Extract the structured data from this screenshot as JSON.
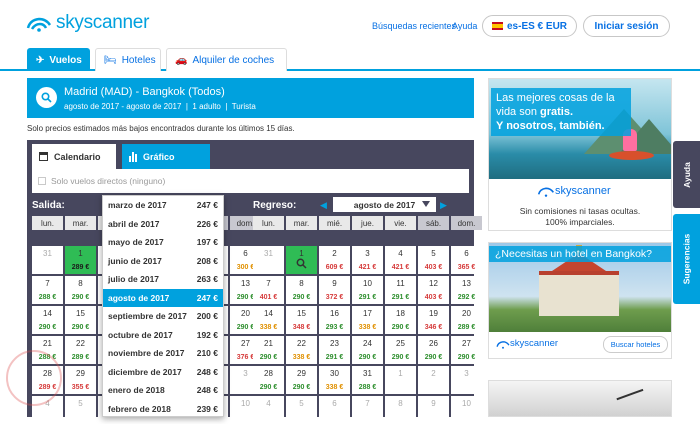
{
  "brand": {
    "name": "skyscanner",
    "color": "#00a1de"
  },
  "header": {
    "recent_searches": "Búsquedas recientes",
    "help": "Ayuda",
    "locale": "es-ES € EUR",
    "login": "Iniciar sesión"
  },
  "tabs": [
    {
      "label": "Vuelos",
      "icon": "plane-icon"
    },
    {
      "label": "Hoteles",
      "icon": "bed-icon"
    },
    {
      "label": "Alquiler de coches",
      "icon": "car-icon"
    }
  ],
  "search": {
    "route": "Madrid (MAD) - Bangkok (Todos)",
    "dates": "agosto de 2017 - agosto de 2017",
    "adults": "1 adulto",
    "cabin": "Turista"
  },
  "estimate_note": "Solo precios estimados más bajos encontrados durante los últimos 15 días.",
  "calendar": {
    "tab_calendar": "Calendario",
    "tab_chart": "Gráfico",
    "direct_only": "Solo vuelos directos (ninguno)",
    "outbound_label": "Salida:",
    "return_label": "Regreso:",
    "return_month": "agosto de 2017",
    "weekdays": [
      "lun.",
      "mar.",
      "mié.",
      "jue.",
      "vie.",
      "sáb.",
      "dom."
    ],
    "outbound_rows": [
      [
        {
          "d": "31",
          "p": "",
          "c": "",
          "dim": true
        },
        {
          "d": "1",
          "p": "289 €",
          "c": "g",
          "sel": true
        },
        {
          "d": "",
          "p": ""
        },
        {
          "d": "",
          "p": ""
        },
        {
          "d": "",
          "p": ""
        },
        {
          "d": "",
          "p": ""
        },
        {
          "d": "6",
          "p": "300 €",
          "c": "o"
        }
      ],
      [
        {
          "d": "7",
          "p": "288 €",
          "c": "g"
        },
        {
          "d": "8",
          "p": "290 €",
          "c": "g"
        },
        {
          "d": "",
          "p": ""
        },
        {
          "d": "",
          "p": ""
        },
        {
          "d": "",
          "p": ""
        },
        {
          "d": "",
          "p": ""
        },
        {
          "d": "13",
          "p": "290 €",
          "c": "g"
        }
      ],
      [
        {
          "d": "14",
          "p": "290 €",
          "c": "g"
        },
        {
          "d": "15",
          "p": "290 €",
          "c": "g"
        },
        {
          "d": "",
          "p": ""
        },
        {
          "d": "",
          "p": ""
        },
        {
          "d": "",
          "p": ""
        },
        {
          "d": "",
          "p": ""
        },
        {
          "d": "20",
          "p": "290 €",
          "c": "g"
        }
      ],
      [
        {
          "d": "21",
          "p": "288 €",
          "c": "g"
        },
        {
          "d": "22",
          "p": "289 €",
          "c": "g"
        },
        {
          "d": "",
          "p": ""
        },
        {
          "d": "",
          "p": ""
        },
        {
          "d": "",
          "p": ""
        },
        {
          "d": "",
          "p": ""
        },
        {
          "d": "27",
          "p": "376 €",
          "c": "r"
        }
      ],
      [
        {
          "d": "28",
          "p": "289 €",
          "c": "r"
        },
        {
          "d": "29",
          "p": "355 €",
          "c": "r"
        },
        {
          "d": "",
          "p": ""
        },
        {
          "d": "",
          "p": ""
        },
        {
          "d": "",
          "p": ""
        },
        {
          "d": "",
          "p": ""
        },
        {
          "d": "3",
          "p": "",
          "dim": true
        }
      ],
      [
        {
          "d": "4",
          "p": "",
          "dim": true
        },
        {
          "d": "5",
          "p": "",
          "dim": true
        },
        {
          "d": "",
          "p": ""
        },
        {
          "d": "",
          "p": ""
        },
        {
          "d": "",
          "p": ""
        },
        {
          "d": "",
          "p": ""
        },
        {
          "d": "10",
          "p": "",
          "dim": true
        }
      ]
    ],
    "return_rows": [
      [
        {
          "d": "31",
          "p": "",
          "dim": true
        },
        {
          "d": "1",
          "p": "",
          "sel": true,
          "search": true
        },
        {
          "d": "2",
          "p": "609 €",
          "c": "r"
        },
        {
          "d": "3",
          "p": "421 €",
          "c": "r"
        },
        {
          "d": "4",
          "p": "421 €",
          "c": "r"
        },
        {
          "d": "5",
          "p": "403 €",
          "c": "r"
        },
        {
          "d": "6",
          "p": "365 €",
          "c": "r"
        }
      ],
      [
        {
          "d": "7",
          "p": "401 €",
          "c": "r"
        },
        {
          "d": "8",
          "p": "290 €",
          "c": "g"
        },
        {
          "d": "9",
          "p": "372 €",
          "c": "r"
        },
        {
          "d": "10",
          "p": "291 €",
          "c": "g"
        },
        {
          "d": "11",
          "p": "291 €",
          "c": "g"
        },
        {
          "d": "12",
          "p": "403 €",
          "c": "r"
        },
        {
          "d": "13",
          "p": "292 €",
          "c": "g"
        }
      ],
      [
        {
          "d": "14",
          "p": "338 €",
          "c": "o"
        },
        {
          "d": "15",
          "p": "348 €",
          "c": "r"
        },
        {
          "d": "16",
          "p": "293 €",
          "c": "g"
        },
        {
          "d": "17",
          "p": "338 €",
          "c": "o"
        },
        {
          "d": "18",
          "p": "290 €",
          "c": "g"
        },
        {
          "d": "19",
          "p": "346 €",
          "c": "r"
        },
        {
          "d": "20",
          "p": "289 €",
          "c": "g"
        }
      ],
      [
        {
          "d": "21",
          "p": "290 €",
          "c": "g"
        },
        {
          "d": "22",
          "p": "338 €",
          "c": "o"
        },
        {
          "d": "23",
          "p": "291 €",
          "c": "g"
        },
        {
          "d": "24",
          "p": "290 €",
          "c": "g"
        },
        {
          "d": "25",
          "p": "290 €",
          "c": "g"
        },
        {
          "d": "26",
          "p": "290 €",
          "c": "g"
        },
        {
          "d": "27",
          "p": "290 €",
          "c": "g"
        }
      ],
      [
        {
          "d": "28",
          "p": "290 €",
          "c": "g"
        },
        {
          "d": "29",
          "p": "290 €",
          "c": "g"
        },
        {
          "d": "30",
          "p": "338 €",
          "c": "o"
        },
        {
          "d": "31",
          "p": "288 €",
          "c": "g"
        },
        {
          "d": "1",
          "p": "",
          "dim": true
        },
        {
          "d": "2",
          "p": "",
          "dim": true
        },
        {
          "d": "3",
          "p": "",
          "dim": true
        }
      ],
      [
        {
          "d": "4",
          "p": "",
          "dim": true
        },
        {
          "d": "5",
          "p": "",
          "dim": true
        },
        {
          "d": "6",
          "p": "",
          "dim": true
        },
        {
          "d": "7",
          "p": "",
          "dim": true
        },
        {
          "d": "8",
          "p": "",
          "dim": true
        },
        {
          "d": "9",
          "p": "",
          "dim": true
        },
        {
          "d": "10",
          "p": "",
          "dim": true
        }
      ]
    ],
    "month_dropdown": [
      {
        "m": "marzo de 2017",
        "p": "247 €"
      },
      {
        "m": "abril de 2017",
        "p": "226 €"
      },
      {
        "m": "mayo de 2017",
        "p": "197 €"
      },
      {
        "m": "junio de 2017",
        "p": "208 €"
      },
      {
        "m": "julio de 2017",
        "p": "263 €"
      },
      {
        "m": "agosto de 2017",
        "p": "247 €",
        "sel": true
      },
      {
        "m": "septiembre de 2017",
        "p": "200 €"
      },
      {
        "m": "octubre de 2017",
        "p": "192 €"
      },
      {
        "m": "noviembre de 2017",
        "p": "210 €"
      },
      {
        "m": "diciembre de 2017",
        "p": "248 €"
      },
      {
        "m": "enero de 2018",
        "p": "248 €"
      },
      {
        "m": "febrero de 2018",
        "p": "239 €"
      }
    ]
  },
  "ads": {
    "ad1_line1": "Las mejores cosas de la vida son ",
    "ad1_bold1": "gratis.",
    "ad1_bold2": "Y nosotros, también.",
    "ad1_sub1": "Sin comisiones ni tasas ocultas.",
    "ad1_sub2": "100% imparciales.",
    "ad2_head": "¿Necesitas un hotel en Bangkok?",
    "ad2_button": "Buscar hoteles"
  },
  "side_tabs": {
    "help": "Ayuda",
    "suggestions": "Sugerencias"
  }
}
